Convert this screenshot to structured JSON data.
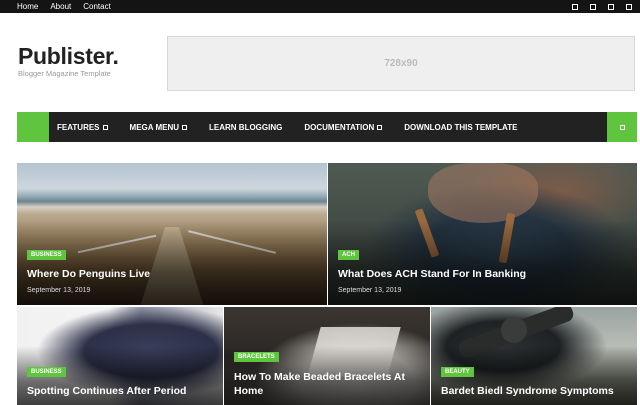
{
  "topbar": {
    "links": [
      "Home",
      "About",
      "Contact"
    ]
  },
  "header": {
    "logo_title": "Publister.",
    "logo_subtitle": "Blogger Magazine Template",
    "ad_label": "728x90"
  },
  "nav": {
    "items": [
      {
        "label": "FEATURES",
        "dropdown": true
      },
      {
        "label": "MEGA MENU",
        "dropdown": true
      },
      {
        "label": "LEARN BLOGGING",
        "dropdown": false
      },
      {
        "label": "DOCUMENTATION",
        "dropdown": true
      },
      {
        "label": "DOWNLOAD THIS TEMPLATE",
        "dropdown": false
      }
    ],
    "accent_color": "#5fc53f"
  },
  "featured": [
    {
      "category": "BUSINESS",
      "title": "Where Do Penguins Live",
      "date": "September 13, 2019",
      "image": "beach-boardwalk"
    },
    {
      "category": "ACH",
      "title": "What Does ACH Stand For In Banking",
      "date": "September 13, 2019",
      "image": "man-with-backpack"
    },
    {
      "category": "BUSINESS",
      "title": "Spotting Continues After Period",
      "date": "",
      "image": "man-in-suit"
    },
    {
      "category": "BRACELETS",
      "title": "How To Make Beaded Bracelets At Home",
      "date": "",
      "image": "laptop-desk"
    },
    {
      "category": "BEAUTY",
      "title": "Bardet Biedl Syndrome Symptoms",
      "date": "",
      "image": "propeller-plane"
    }
  ]
}
